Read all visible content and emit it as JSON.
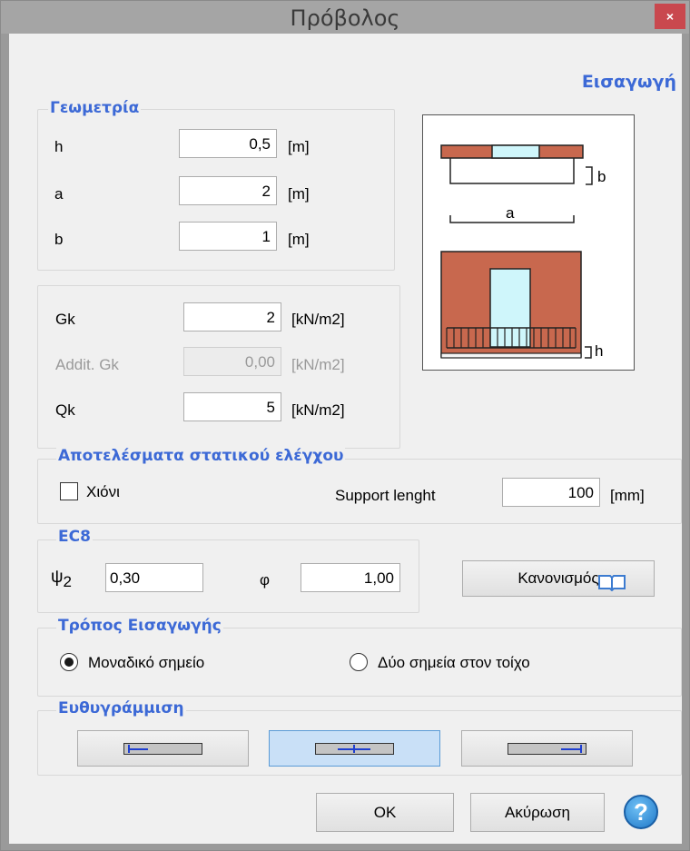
{
  "window": {
    "title": "Πρόβολος",
    "close_label": "×"
  },
  "header_label": "Εισαγωγή",
  "geometry": {
    "title": "Γεωμετρία",
    "rows": [
      {
        "label": "h",
        "value": "0,5",
        "unit": "[m]"
      },
      {
        "label": "a",
        "value": "2",
        "unit": "[m]"
      },
      {
        "label": "b",
        "value": "1",
        "unit": "[m]"
      }
    ]
  },
  "loads": {
    "rows": [
      {
        "label": "Gk",
        "value": "2",
        "unit": "[kN/m2]",
        "enabled": true
      },
      {
        "label": "Addit. Gk",
        "value": "0,00",
        "unit": "[kN/m2]",
        "enabled": false
      },
      {
        "label": "Qk",
        "value": "5",
        "unit": "[kN/m2]",
        "enabled": true
      }
    ]
  },
  "diagram": {
    "label_b": "b",
    "label_a": "a",
    "label_h": "h",
    "colors": {
      "brick": "#c8684e",
      "glass": "#cff6fb"
    }
  },
  "results": {
    "title": "Αποτελέσματα στατικού ελέγχου",
    "snow_label": "Χιόνι",
    "snow_checked": false,
    "support_label": "Support lenght",
    "support_value": "100",
    "support_unit": "[mm]"
  },
  "ec8": {
    "title": "EC8",
    "psi_label": "ψ",
    "psi_subscript": "2",
    "psi_value": "0,30",
    "phi_label": "φ",
    "phi_value": "1,00"
  },
  "regulation_button": "Κανονισμός",
  "input_mode": {
    "title": "Τρόπος Εισαγωγής",
    "options": [
      {
        "label": "Μοναδικό σημείο",
        "selected": true
      },
      {
        "label": "Δύο σημεία στον τοίχο",
        "selected": false
      }
    ]
  },
  "alignment": {
    "title": "Ευθυγράμμιση",
    "options": [
      "left",
      "center",
      "right"
    ],
    "selected": "center",
    "marker_color": "#1f3fd0"
  },
  "footer": {
    "ok_label": "OK",
    "cancel_label": "Ακύρωση",
    "help_label": "?"
  },
  "colors": {
    "group_title": "#3c69d6",
    "close_bg": "#c9484e",
    "help_bg": "#2f8fd8"
  }
}
